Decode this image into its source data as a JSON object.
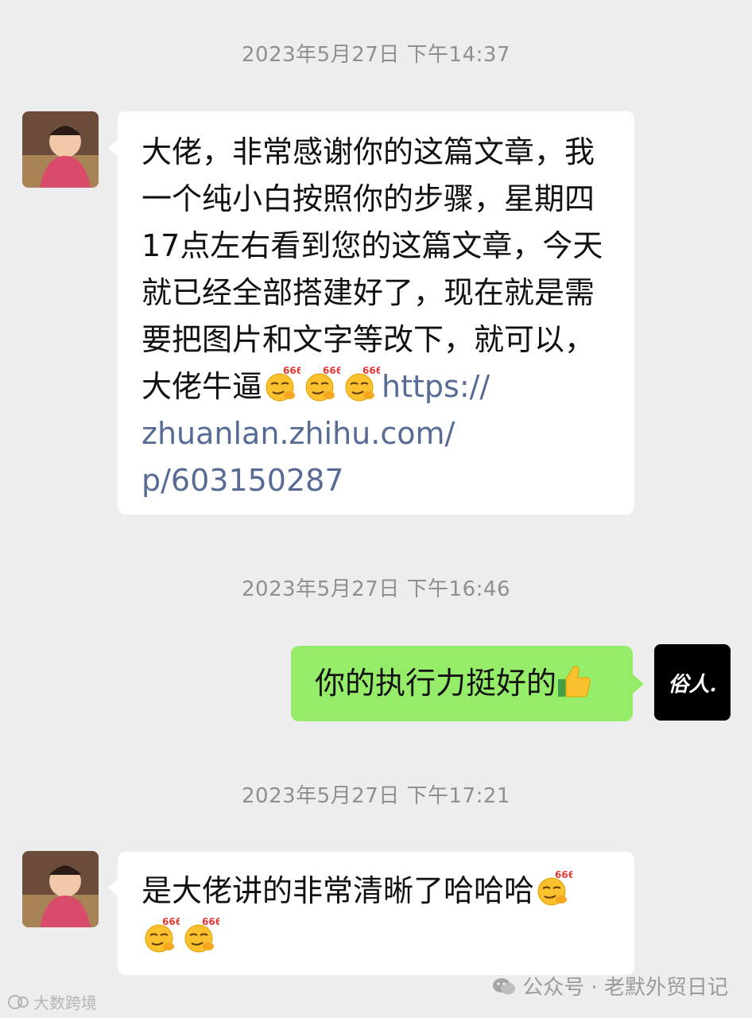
{
  "timestamps": [
    "2023年5月27日 下午14:37",
    "2023年5月27日 下午16:46",
    "2023年5月27日 下午17:21"
  ],
  "messages": [
    {
      "lines": [
        "大佬，非常感谢你的这篇文章，我",
        "一个纯小白按照你的步骤，星期四",
        "17点左右看到您的这篇文章，今天",
        "就已经全部搭建好了，现在就是需",
        "要把图片和文字等改下，就可以，",
        "大佬牛逼"
      ],
      "link_lines": [
        "https://",
        "zhuanlan.zhihu.com/",
        "p/603150287"
      ]
    },
    {
      "text": "你的执行力挺好的"
    },
    {
      "line1": "是大佬讲的非常清晰了哈哈哈"
    }
  ],
  "emoji": {
    "label": "666",
    "name": "smirk-666-emoji"
  },
  "avatar_right_text": "俗人.",
  "footer": {
    "left_text": "大数跨境",
    "right_text": "公众号 · 老默外贸日记"
  },
  "colors": {
    "background": "#ededed",
    "bubble_left": "#ffffff",
    "bubble_right": "#95ec69",
    "link": "#576b95"
  }
}
